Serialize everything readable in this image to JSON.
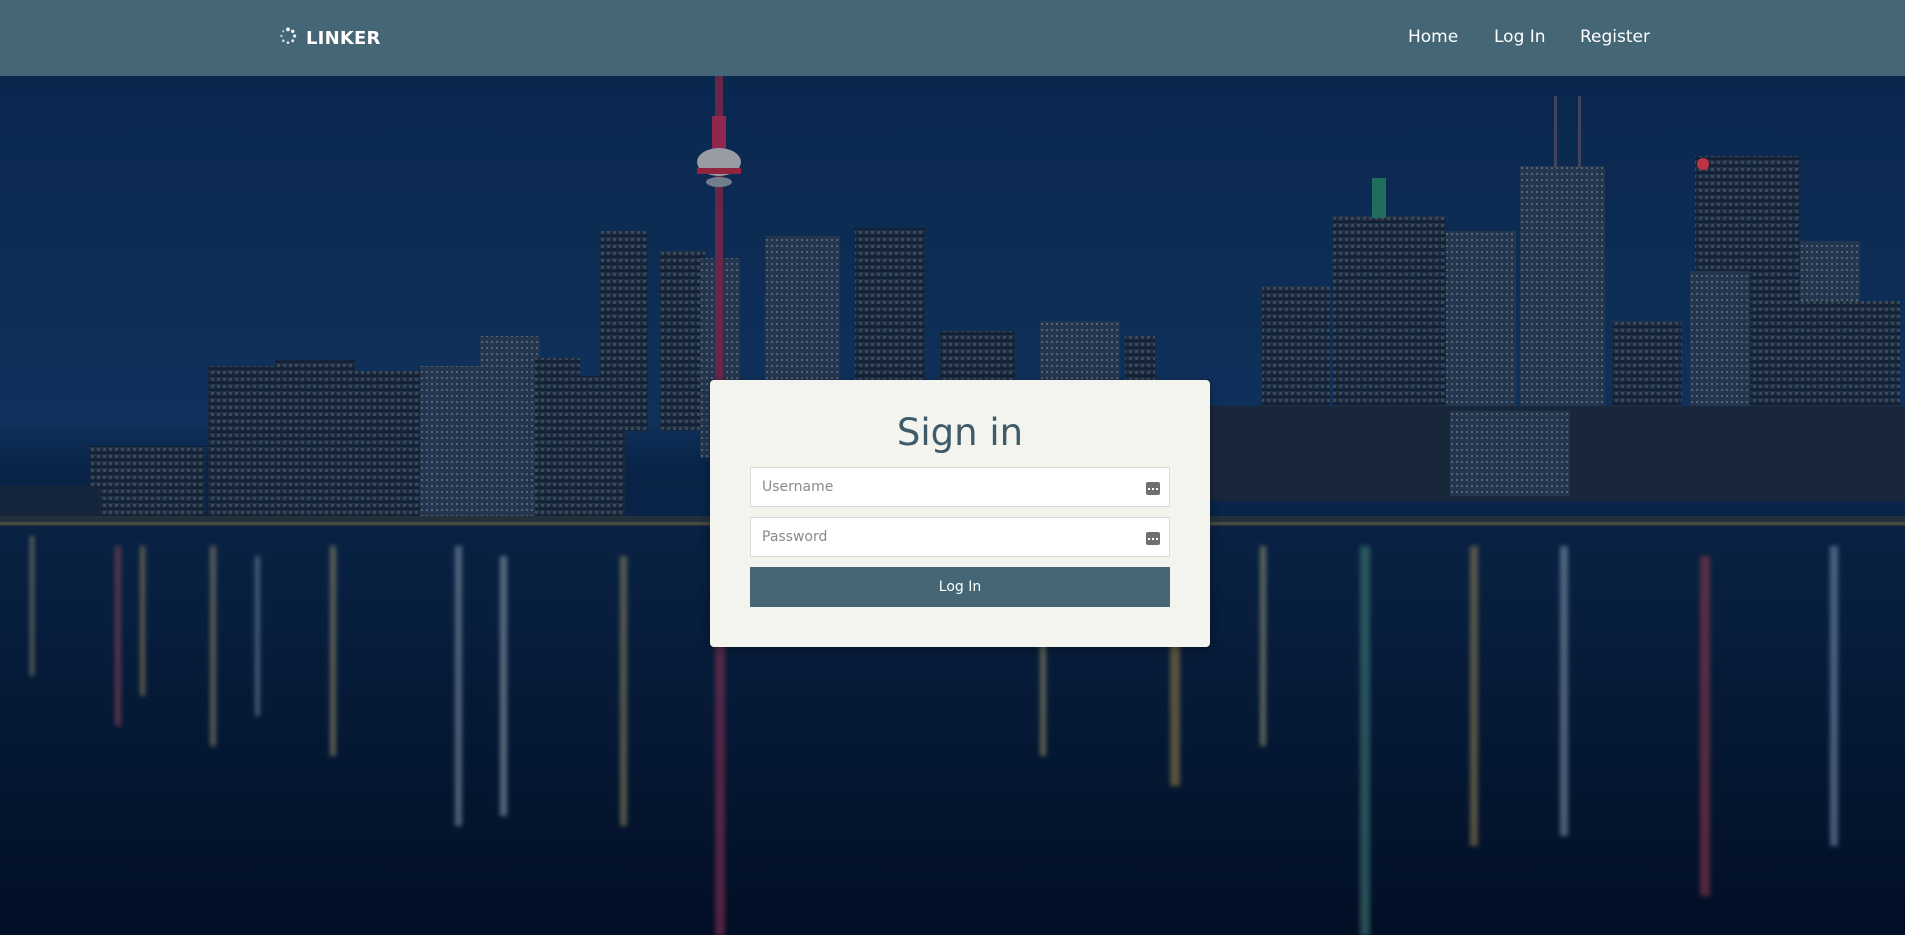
{
  "navbar": {
    "brand": "LINKER",
    "links": [
      {
        "label": "Home"
      },
      {
        "label": "Log In"
      },
      {
        "label": "Register"
      }
    ]
  },
  "signin": {
    "title": "Sign in",
    "username_placeholder": "Username",
    "password_placeholder": "Password",
    "submit_label": "Log In"
  },
  "icons": {
    "brand": "spinner-icon",
    "username_field": "credentials-icon",
    "password_field": "credentials-icon"
  },
  "colors": {
    "navbar": "#456674",
    "card": "#f4f4ef",
    "title": "#3e5b6a",
    "button": "#456674"
  }
}
